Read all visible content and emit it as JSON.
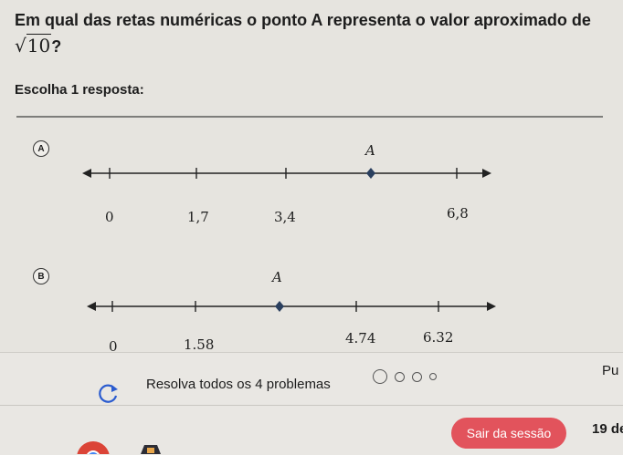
{
  "question": {
    "text": "Em qual das retas numéricas o ponto A representa o valor aproximado de",
    "radicand": "10",
    "suffix": "?"
  },
  "prompt": "Escolha 1 resposta:",
  "options": [
    {
      "letter": "A",
      "point_label": "A",
      "tick_labels": [
        "0",
        "1,7",
        "3,4",
        "6,8"
      ]
    },
    {
      "letter": "B",
      "point_label": "A",
      "tick_labels": [
        "0",
        "1.58",
        "4.74",
        "6.32"
      ]
    }
  ],
  "footer": {
    "resolve_text": "Resolva todos os 4 problemas",
    "progress_total": 4,
    "pu_text": "Pu",
    "logout_label": "Sair da sessão",
    "date_text": "19 de"
  },
  "colors": {
    "point": "#2a3f5e",
    "logout": "#e2535c"
  },
  "icons": {
    "restart": "restart-arrow-icon"
  }
}
